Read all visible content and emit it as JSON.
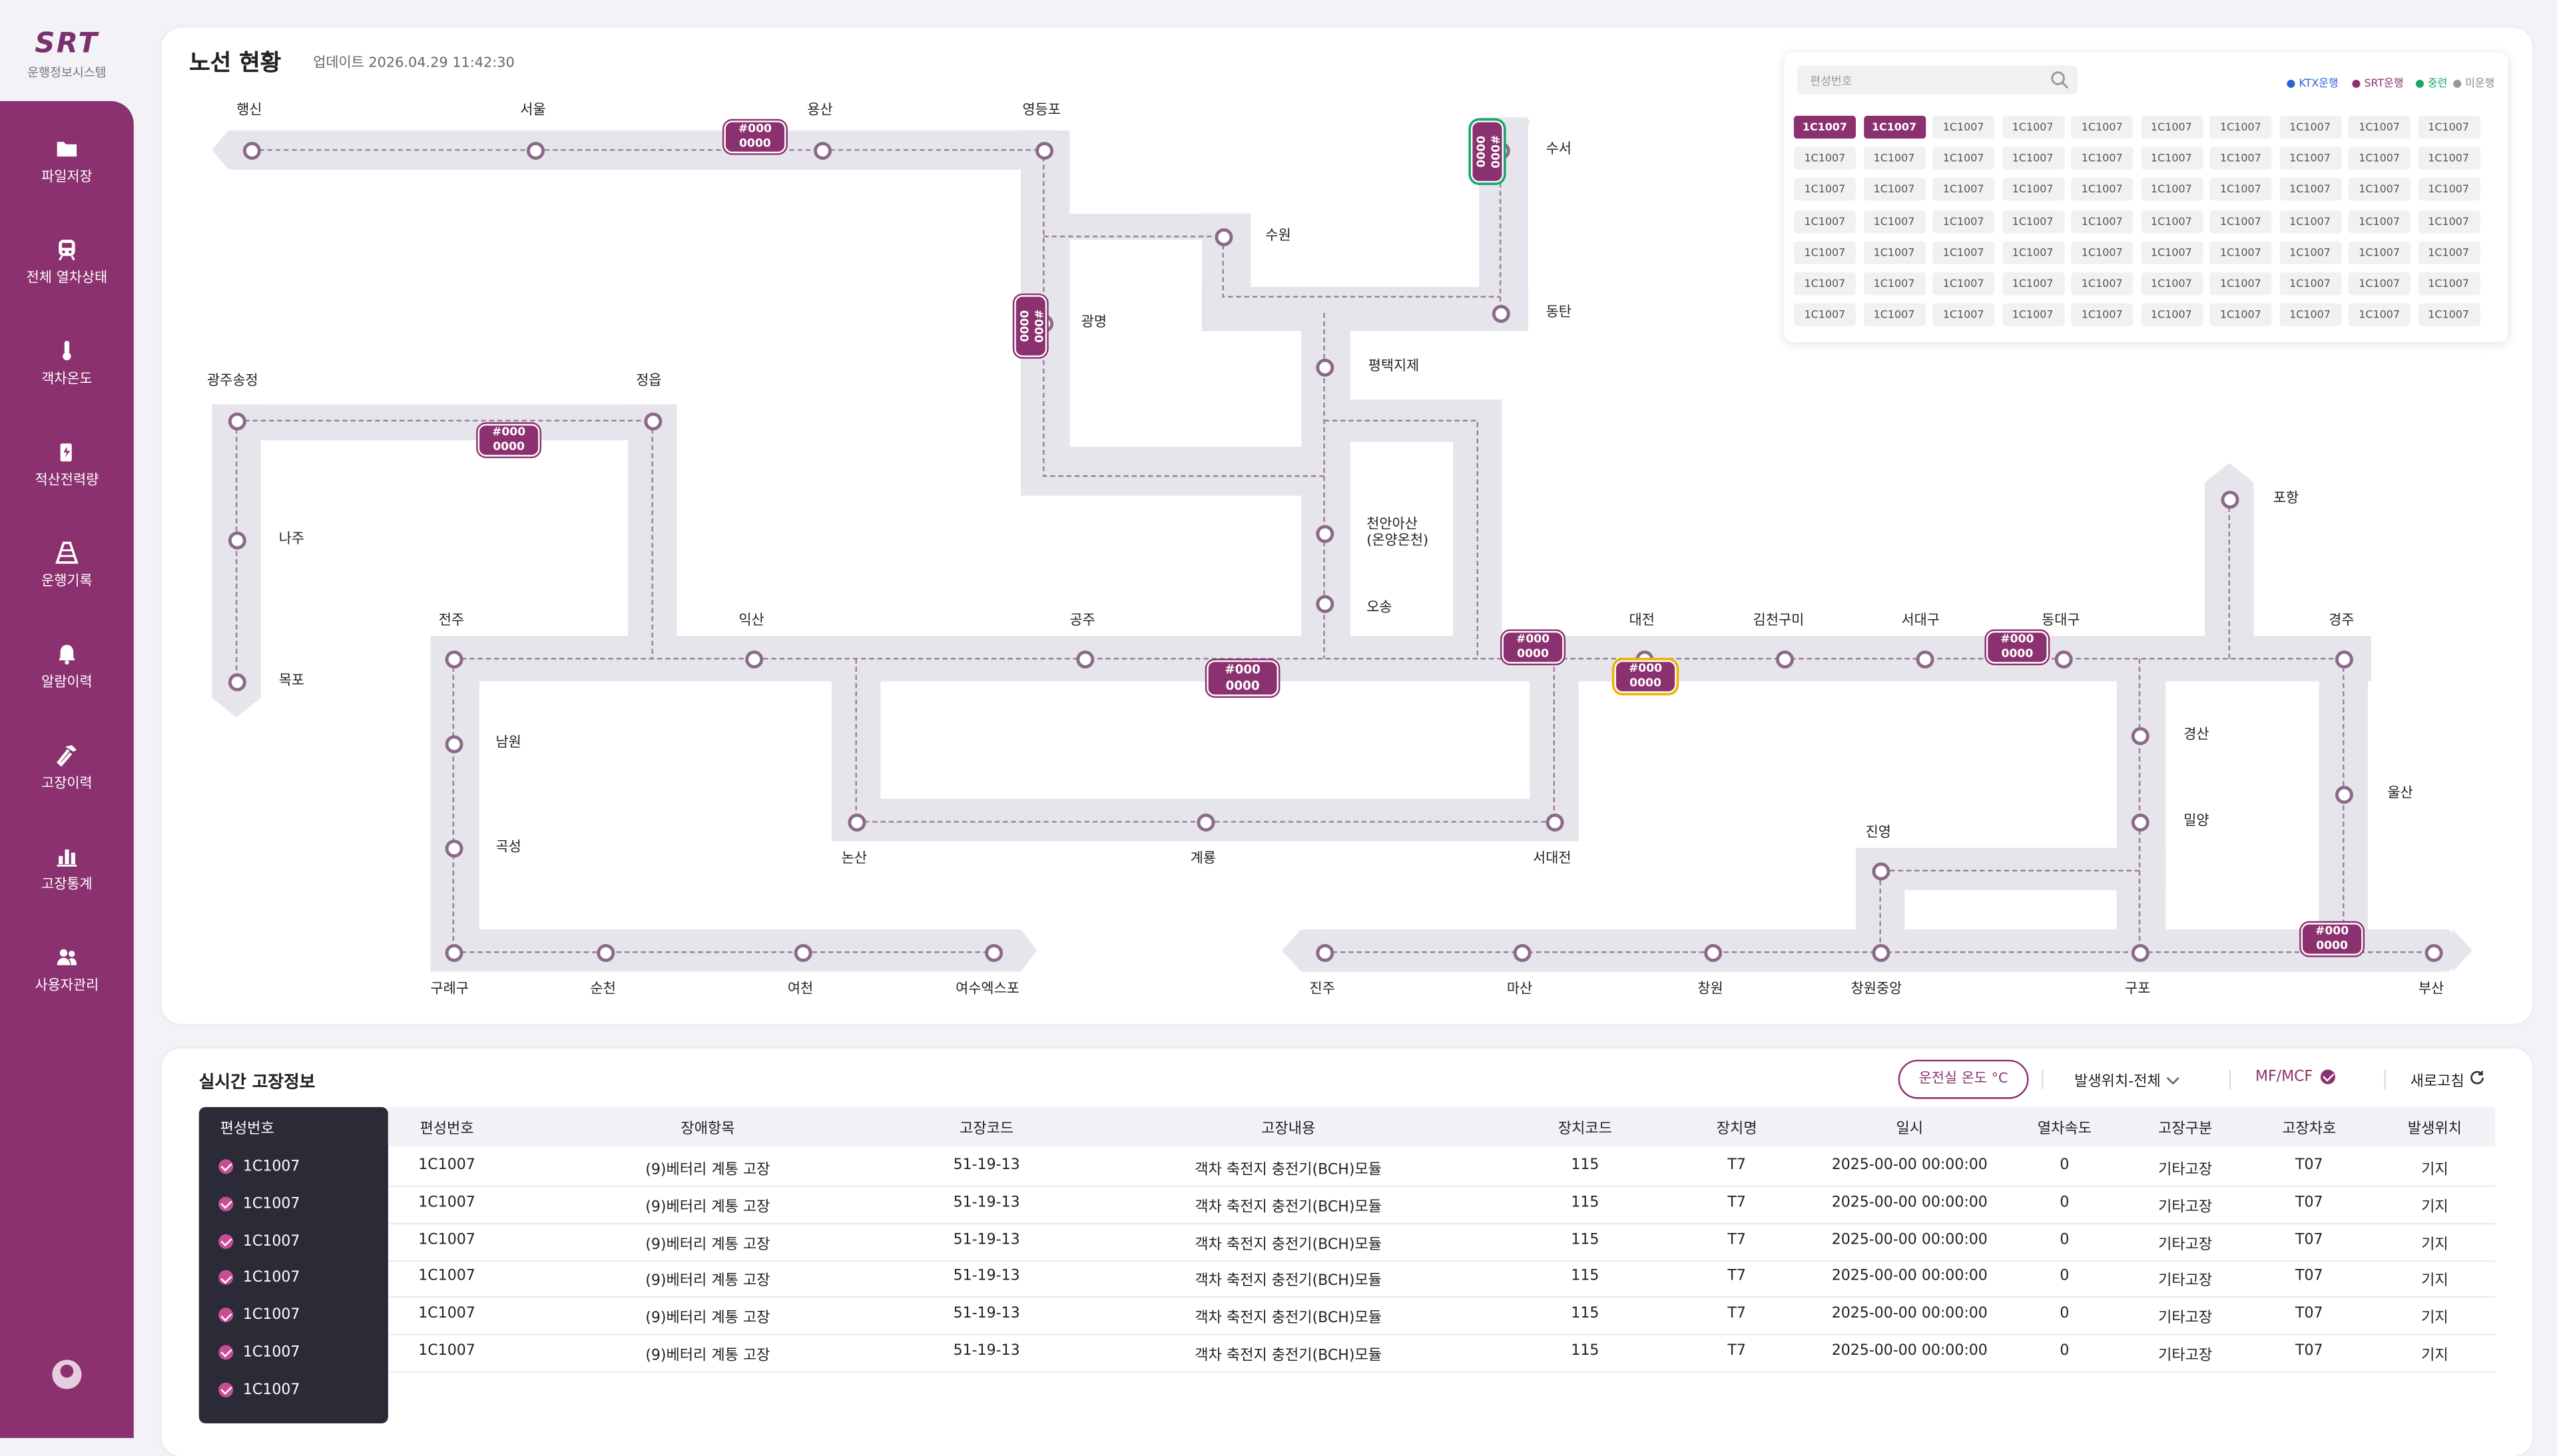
{
  "app": {
    "brand": "SRT",
    "subtitle": "운행정보시스템"
  },
  "sidebar": {
    "items": [
      {
        "label": "파일저장",
        "icon": "folder-icon"
      },
      {
        "label": "전체 열차상태",
        "icon": "train-icon"
      },
      {
        "label": "객차온도",
        "icon": "thermometer-icon"
      },
      {
        "label": "적산전력량",
        "icon": "power-meter-icon"
      },
      {
        "label": "운행기록",
        "icon": "road-icon"
      },
      {
        "label": "알람이력",
        "icon": "bell-icon"
      },
      {
        "label": "고장이력",
        "icon": "hammer-icon"
      },
      {
        "label": "고장통계",
        "icon": "bar-chart-icon"
      },
      {
        "label": "사용자관리",
        "icon": "users-icon"
      }
    ]
  },
  "map": {
    "title": "노선 현황",
    "updated": "업데이트 2026.04.29 11:42:30",
    "stations": [
      "행신",
      "서울",
      "용산",
      "영등포",
      "수서",
      "수원",
      "광명",
      "동탄",
      "평택지제",
      "광주송정",
      "정읍",
      "나주",
      "목포",
      "천안아산\n(온양온천)",
      "오송",
      "포항",
      "전주",
      "익산",
      "공주",
      "대전",
      "김천구미",
      "서대구",
      "동대구",
      "경주",
      "남원",
      "곡성",
      "경산",
      "밀양",
      "울산",
      "논산",
      "계룡",
      "서대전",
      "진영",
      "구례구",
      "순천",
      "여천",
      "여수엑스포",
      "진주",
      "마산",
      "창원",
      "창원중앙",
      "구포",
      "부산"
    ],
    "train_badges": [
      {
        "line1": "#000",
        "line2": "0000"
      },
      {
        "line1": "#000",
        "line2": "0000"
      },
      {
        "line1": "#000",
        "line2": "0000"
      },
      {
        "line1": "#000",
        "line2": "0000"
      },
      {
        "line1": "#000",
        "line2": "0000"
      },
      {
        "line1": "#000",
        "line2": "0000"
      },
      {
        "line1": "#000",
        "line2": "0000"
      },
      {
        "line1": "#000",
        "line2": "0000"
      },
      {
        "line1": "#000",
        "line2": "0000"
      }
    ]
  },
  "train_search": {
    "placeholder": "편성번호",
    "legend": [
      {
        "label": "KTX운행",
        "color": "#2a63d6"
      },
      {
        "label": "SRT운행",
        "color": "#8b316f"
      },
      {
        "label": "중련",
        "color": "#1aa86a"
      },
      {
        "label": "미운행",
        "color": "#999999"
      }
    ],
    "cell_label": "1C1007",
    "rows": 7,
    "cols": 10
  },
  "faults": {
    "title": "실시간 고장정보",
    "temp_button": "운전실 온도 °C",
    "location_filter": "발생위치-전체",
    "mf_label": "MF/MCF",
    "refresh_label": "새로고침",
    "side_header": "편성번호",
    "side_items": [
      "1C1007",
      "1C1007",
      "1C1007",
      "1C1007",
      "1C1007",
      "1C1007",
      "1C1007"
    ],
    "columns": [
      "편성번호",
      "장애항목",
      "고장코드",
      "고장내용",
      "장치코드",
      "장치명",
      "일시",
      "열차속도",
      "고장구분",
      "고장차호",
      "발생위치"
    ],
    "rows": [
      [
        "1C1007",
        "(9)베터리 계통 고장",
        "51-19-13",
        "객차 축전지 충전기(BCH)모듈",
        "115",
        "T7",
        "2025-00-00 00:00:00",
        "0",
        "기타고장",
        "T07",
        "기지"
      ],
      [
        "1C1007",
        "(9)베터리 계통 고장",
        "51-19-13",
        "객차 축전지 충전기(BCH)모듈",
        "115",
        "T7",
        "2025-00-00 00:00:00",
        "0",
        "기타고장",
        "T07",
        "기지"
      ],
      [
        "1C1007",
        "(9)베터리 계통 고장",
        "51-19-13",
        "객차 축전지 충전기(BCH)모듈",
        "115",
        "T7",
        "2025-00-00 00:00:00",
        "0",
        "기타고장",
        "T07",
        "기지"
      ],
      [
        "1C1007",
        "(9)베터리 계통 고장",
        "51-19-13",
        "객차 축전지 충전기(BCH)모듈",
        "115",
        "T7",
        "2025-00-00 00:00:00",
        "0",
        "기타고장",
        "T07",
        "기지"
      ],
      [
        "1C1007",
        "(9)베터리 계통 고장",
        "51-19-13",
        "객차 축전지 충전기(BCH)모듈",
        "115",
        "T7",
        "2025-00-00 00:00:00",
        "0",
        "기타고장",
        "T07",
        "기지"
      ],
      [
        "1C1007",
        "(9)베터리 계통 고장",
        "51-19-13",
        "객차 축전지 충전기(BCH)모듈",
        "115",
        "T7",
        "2025-00-00 00:00:00",
        "0",
        "기타고장",
        "T07",
        "기지"
      ]
    ]
  }
}
